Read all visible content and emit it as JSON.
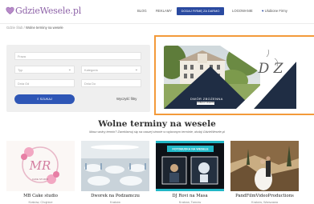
{
  "header": {
    "logo_text": "GdzieWesele.pl",
    "nav": [
      {
        "label": "BLOG"
      },
      {
        "label": "REKLAMY"
      },
      {
        "label": "DODAJ FIRMĘ ZA DARMO"
      },
      {
        "label": "LOGOWANIE"
      },
      {
        "label": "Ulubione Firmy"
      }
    ],
    "accent_color": "#2a4aa0"
  },
  "breadcrumb": {
    "home": "Gdzie Ślub",
    "separator": "/",
    "current": "Wolne terminy na wesele"
  },
  "search": {
    "keyword_placeholder": "Fraza",
    "type_select": "Typ",
    "category_select": "Kategoria",
    "date_from_placeholder": "Dnia Od",
    "date_to_placeholder": "Dnia Do",
    "search_button": "SZUKAJ",
    "clear_link": "Wyczyść filtry",
    "search_icon": "search-icon"
  },
  "ad": {
    "title": "DWÓR ZBOŻENNA",
    "button": "ZOBACZ OFERTĘ",
    "monogram": "D Z",
    "border_color": "#f39a3a"
  },
  "section": {
    "title": "Wolne terminy na wesele",
    "subtitle": "Masz wolny termin? Zareklamuj się na naszej stronie w wybranym terminie, dodaj GdzieWesele.pl"
  },
  "cards": [
    {
      "name": "MB Cake studio",
      "place": "Kraków, Chojnice",
      "image_text": "CAKE STUDIO"
    },
    {
      "name": "Dworek na Podzamczu",
      "place": "Kraków"
    },
    {
      "name": "DJ Rovi na Masa",
      "place": "Kraków, Tarnów",
      "image_text": "FOTOBUDKA NA WESELE"
    },
    {
      "name": "PandFilmVideoProductions",
      "place": "Kraków, Warszawa"
    }
  ]
}
